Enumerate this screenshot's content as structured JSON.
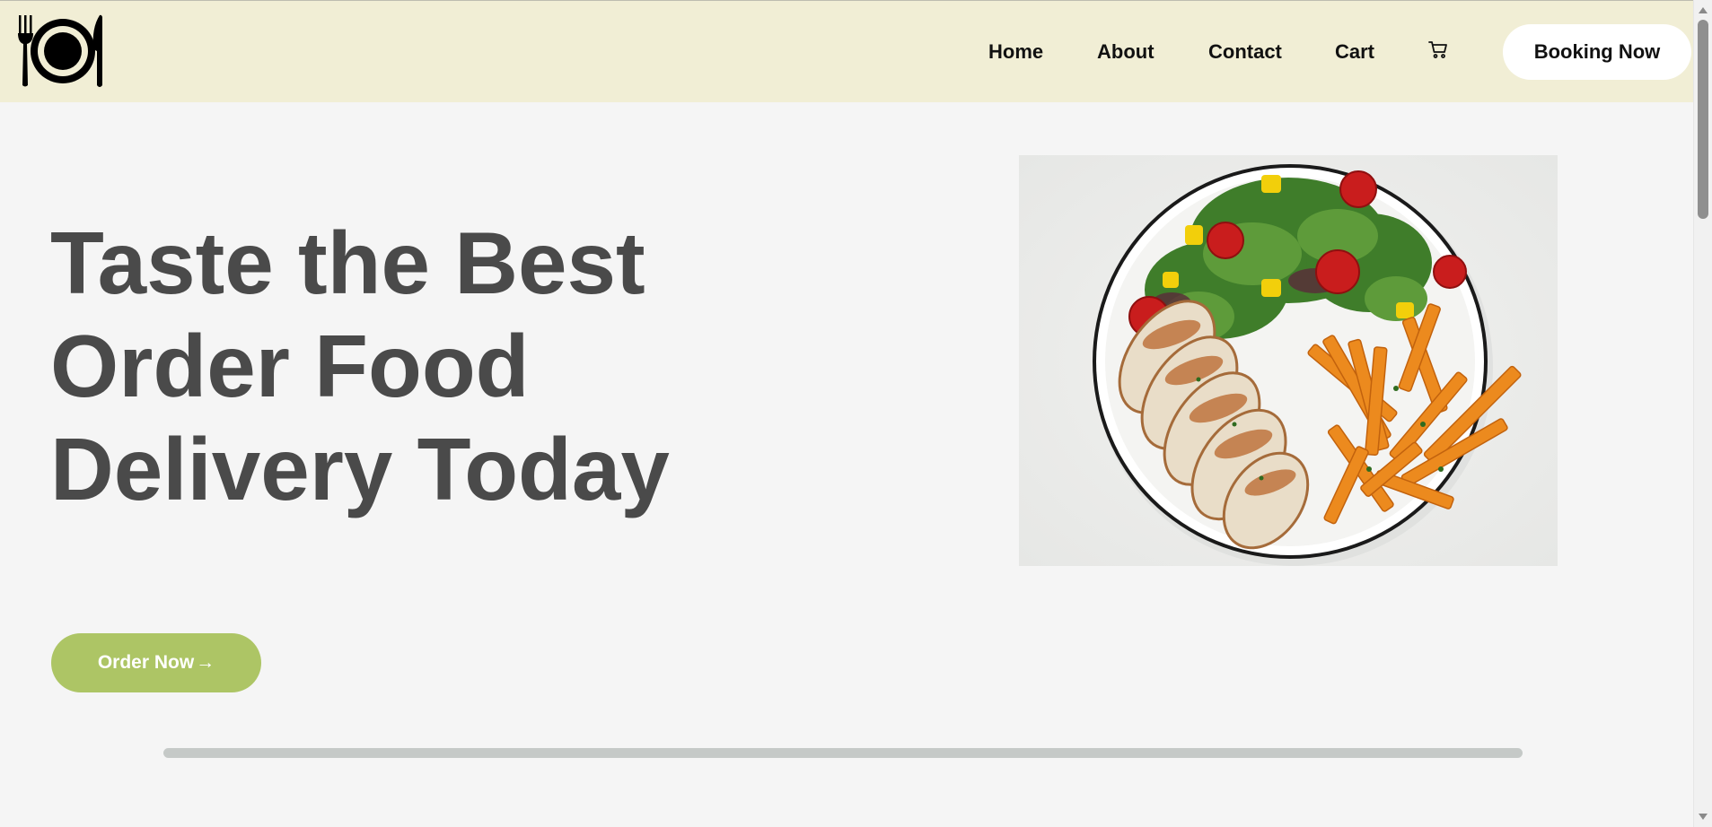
{
  "nav": {
    "logo_icon": "plate-fork-knife-icon",
    "links": [
      "Home",
      "About",
      "Contact",
      "Cart"
    ],
    "cart_icon": "shopping-cart-icon",
    "booking_label": "Booking Now"
  },
  "hero": {
    "title_lines": [
      "Taste the Best",
      "Order Food",
      "Delivery Today"
    ],
    "order_button_label": "Order Now",
    "order_button_arrow": "→",
    "image_alt": "Plate of sliced grilled chicken, sweet potato fries and mixed salad",
    "slider_progress": 1.0
  },
  "colors": {
    "header_bg": "#f1eed5",
    "page_bg": "#f5f5f5",
    "title_color": "#4a4a4a",
    "order_button_bg": "#adc565",
    "booking_button_bg": "#ffffff",
    "track_color": "#c5c9c7"
  }
}
